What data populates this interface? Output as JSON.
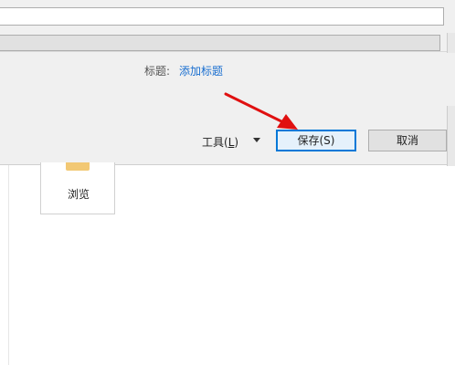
{
  "dialog": {
    "filename_value": "",
    "savetype_value": "",
    "title_label": "标题:",
    "title_link": "添加标题",
    "tools_label_prefix": "工具(",
    "tools_label_key": "L",
    "tools_label_suffix": ")",
    "save_button": "保存(S)",
    "cancel_button": "取消"
  },
  "file_area": {
    "folder_label": "浏览"
  },
  "colors": {
    "annotation_arrow": "#e01010",
    "link": "#1a6fd0",
    "save_border": "#0078d7"
  }
}
